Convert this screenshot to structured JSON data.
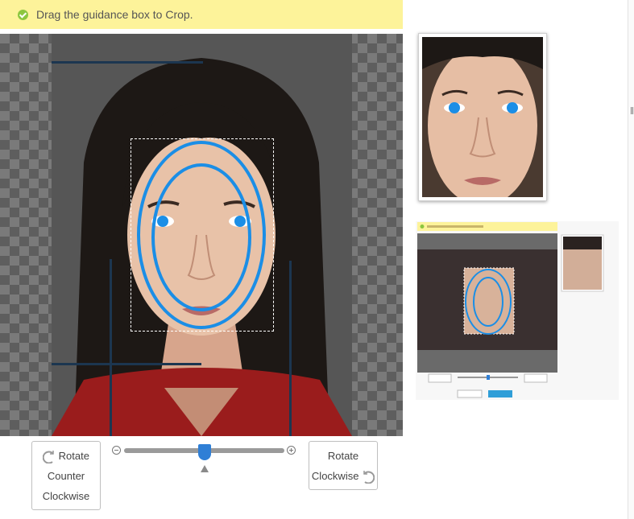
{
  "notice": {
    "text": "Drag the guidance box to Crop.",
    "icon": "check-circle-icon",
    "background": "#fdf39a"
  },
  "controls": {
    "rotate_ccw": {
      "line1": "Rotate",
      "line2": "Counter",
      "line3": "Clockwise",
      "icon": "rotate-ccw-icon"
    },
    "rotate_cw": {
      "line1": "Rotate",
      "line2": "Clockwise",
      "icon": "rotate-cw-icon"
    },
    "zoom": {
      "value": 0.5,
      "min_icon": "zoom-out-icon",
      "max_icon": "zoom-in-icon"
    }
  },
  "colors": {
    "accent": "#2f7fd6",
    "guide_ellipse": "#1b8ee6",
    "guide_line": "#1c3650"
  }
}
